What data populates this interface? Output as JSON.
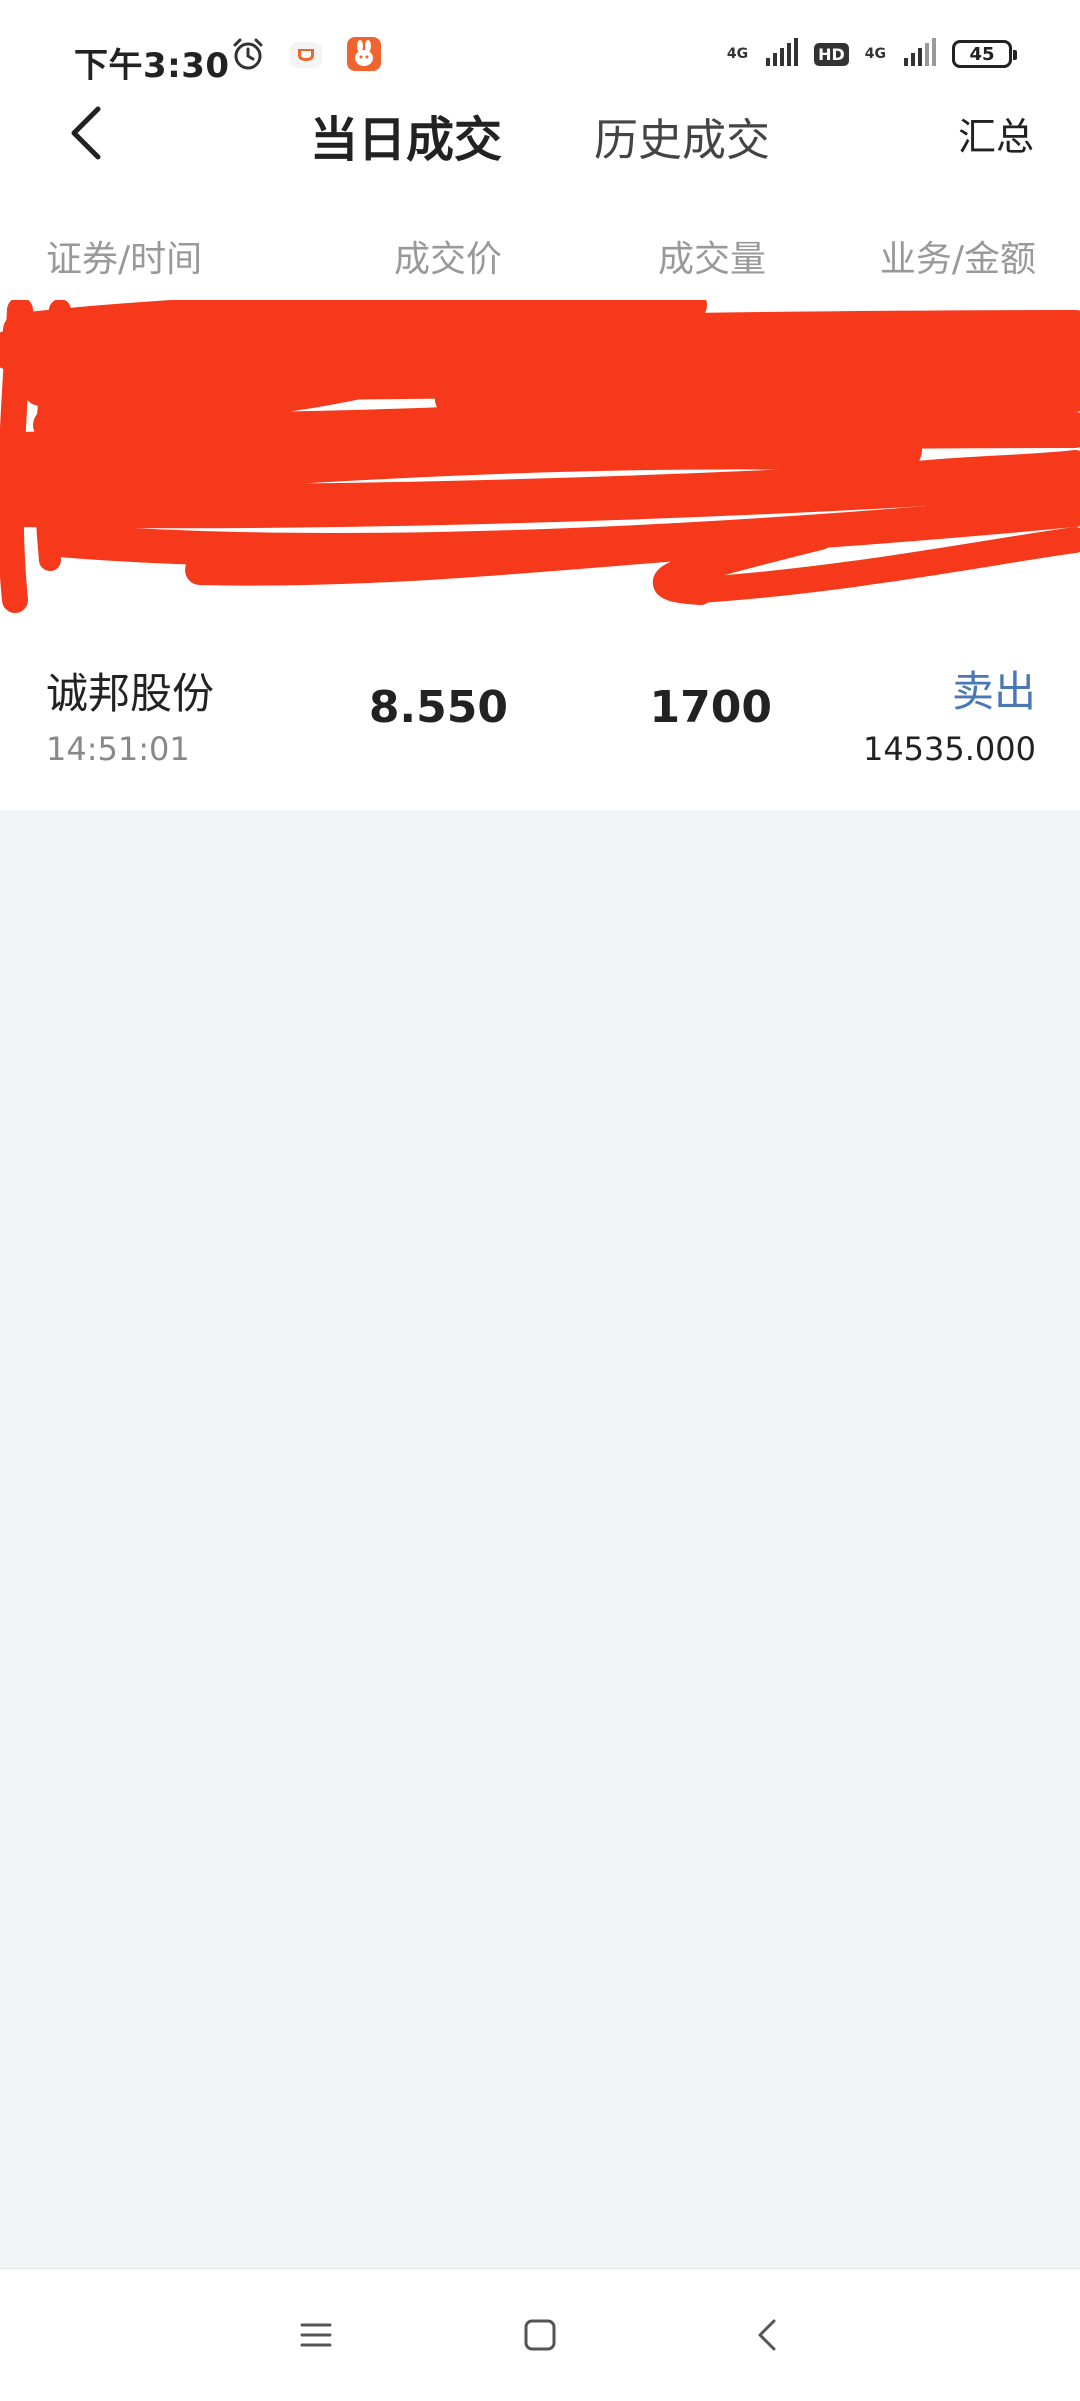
{
  "status": {
    "time": "下午3:30",
    "net1": "4G",
    "hd": "HD",
    "net2": "4G",
    "battery": "45"
  },
  "nav": {
    "tab_today": "当日成交",
    "tab_history": "历史成交",
    "summary": "汇总"
  },
  "table": {
    "headers": {
      "security_time": "证券/时间",
      "price": "成交价",
      "volume": "成交量",
      "side_amount": "业务/金额"
    },
    "rows": [
      {
        "name": "诚邦股份",
        "time": "14:51:01",
        "price": "8.550",
        "volume": "1700",
        "side": "卖出",
        "amount": "14535.000"
      }
    ]
  },
  "colors": {
    "accent_blue": "#4a78b5",
    "redaction_red": "#f5391a",
    "app_icon_orange": "#f0652d"
  },
  "icons": [
    "alarm-icon",
    "cup-app-icon",
    "rabbit-app-icon",
    "signal-icon",
    "back-icon",
    "menu-icon",
    "home-icon",
    "system-back-icon"
  ]
}
